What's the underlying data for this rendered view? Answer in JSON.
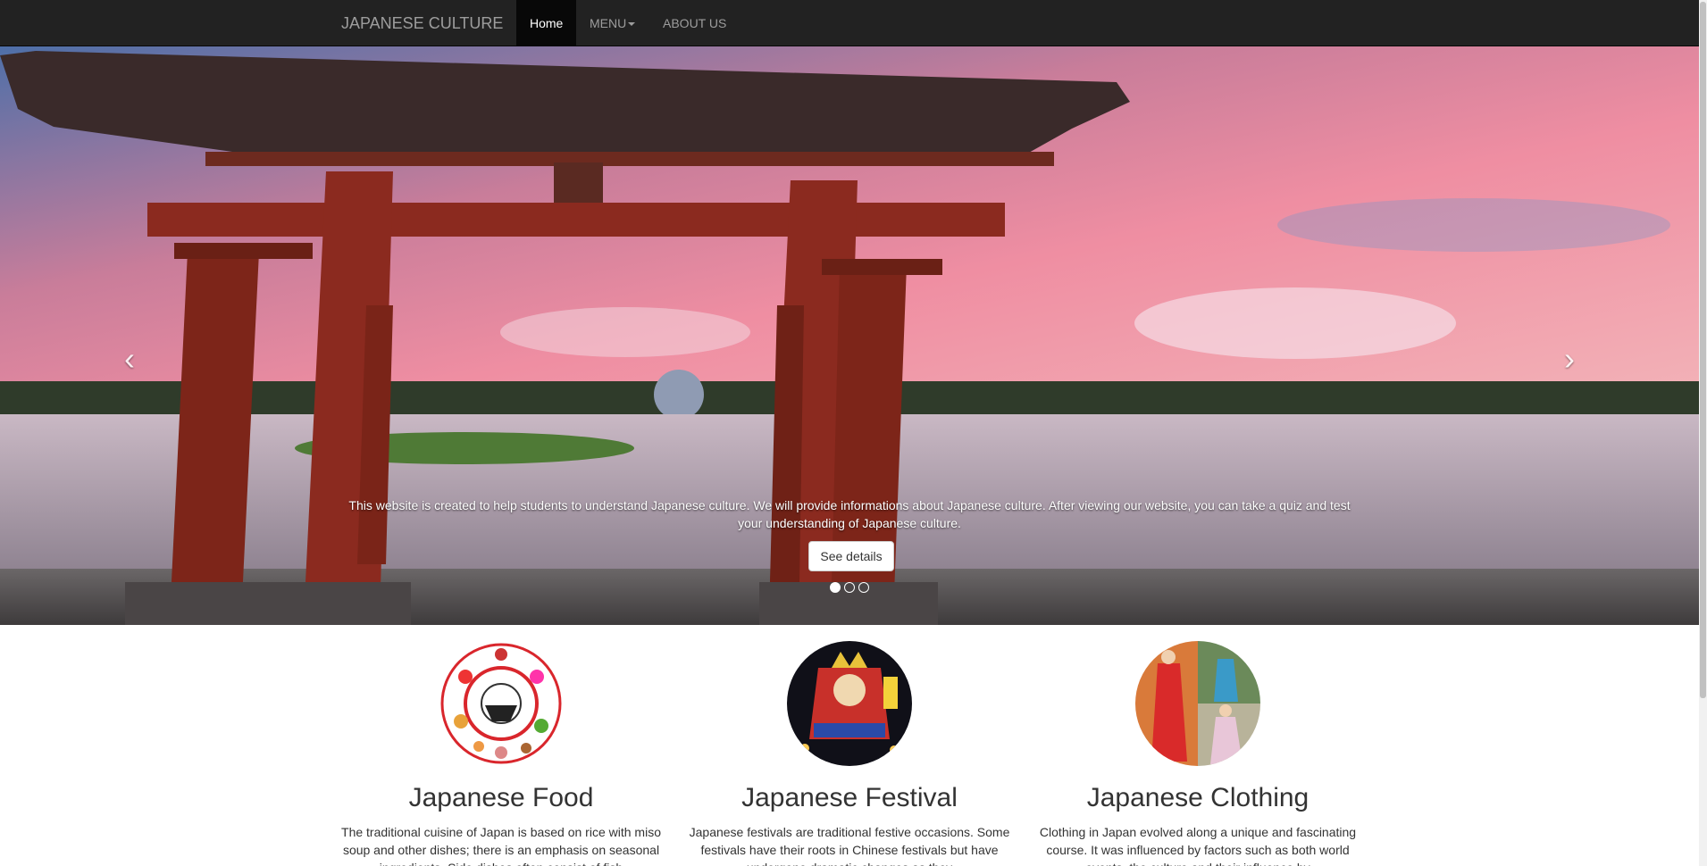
{
  "nav": {
    "brand": "JAPANESE CULTURE",
    "home": "Home",
    "menu": "MENU",
    "about": "ABOUT US"
  },
  "carousel": {
    "caption": "This website is created to help students to understand Japanese culture. We will provide informations about Japanese culture. After viewing our website, you can take a quiz and test your understanding of Japanese culture.",
    "button": "See details",
    "prev_glyph": "‹",
    "next_glyph": "›",
    "slide_count": 3,
    "active_slide": 1
  },
  "features": [
    {
      "title": "Japanese Food",
      "text": "The traditional cuisine of Japan is based on rice with miso soup and other dishes; there is an emphasis on seasonal ingredients. Side dishes often consist of fish"
    },
    {
      "title": "Japanese Festival",
      "text": "Japanese festivals are traditional festive occasions. Some festivals have their roots in Chinese festivals but have undergone dramatic changes as they"
    },
    {
      "title": "Japanese Clothing",
      "text": "Clothing in Japan evolved along a unique and fascinating course. It was influenced by factors such as both world events, the culture and their influence by"
    }
  ],
  "colors": {
    "navbar": "#222222",
    "nav_active": "#080808",
    "torii": "#8b2a1f",
    "sky_pink": "#e88aa0",
    "sky_blue": "#6f8fbf",
    "water": "#b9a9b5"
  }
}
